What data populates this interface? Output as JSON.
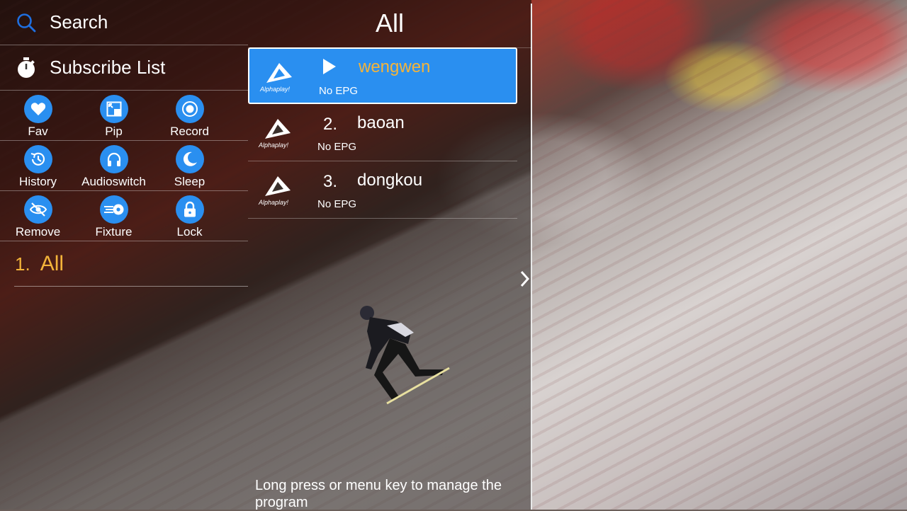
{
  "menu": {
    "search_label": "Search",
    "subscribe_label": "Subscribe List"
  },
  "actions": [
    {
      "label": "Fav",
      "icon": "heart-icon"
    },
    {
      "label": "Pip",
      "icon": "pip-icon"
    },
    {
      "label": "Record",
      "icon": "record-icon"
    },
    {
      "label": "History",
      "icon": "history-icon"
    },
    {
      "label": "Audioswitch",
      "icon": "headphones-icon"
    },
    {
      "label": "Sleep",
      "icon": "moon-icon"
    },
    {
      "label": "Remove",
      "icon": "eye-off-icon"
    },
    {
      "label": "Fixture",
      "icon": "soccer-ball-icon"
    },
    {
      "label": "Lock",
      "icon": "lock-icon"
    }
  ],
  "groups": [
    {
      "number": "1.",
      "name": "All",
      "selected": true
    }
  ],
  "channel_list": {
    "title": "All",
    "channels": [
      {
        "number": "",
        "name": "wengwen",
        "epg": "No EPG",
        "logo_text": "Alphaplay!",
        "playing": true
      },
      {
        "number": "2.",
        "name": "baoan",
        "epg": "No EPG",
        "logo_text": "Alphaplay!",
        "playing": false
      },
      {
        "number": "3.",
        "name": "dongkou",
        "epg": "No EPG",
        "logo_text": "Alphaplay!",
        "playing": false
      }
    ]
  },
  "hint": "Long press or menu key to manage the program",
  "colors": {
    "accent": "#2a8ff0",
    "highlight_text": "#f4b43a",
    "search_icon": "#1f6fe0"
  }
}
